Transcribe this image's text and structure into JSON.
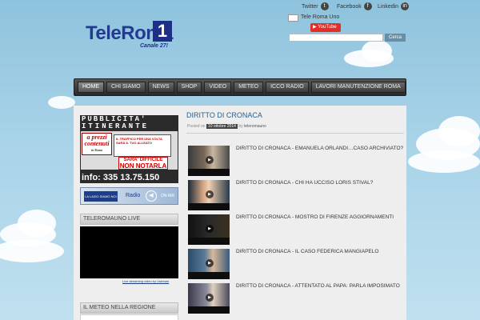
{
  "header": {
    "logo": {
      "word1": "Tele",
      "word2": "Roma",
      "number": "1",
      "tagline": "Canale 27!"
    },
    "social": [
      {
        "label": "Twitter",
        "icon": "twitter-icon"
      },
      {
        "label": "Facebook",
        "icon": "facebook-icon"
      },
      {
        "label": "Linkedin",
        "icon": "linkedin-icon"
      }
    ],
    "facebook_widget": {
      "page_name": "Tele Roma Uno",
      "youtube_label": "YouTube"
    },
    "search": {
      "placeholder": "",
      "button_label": "Cerca"
    }
  },
  "nav": {
    "items": [
      {
        "label": "HOME",
        "active": true
      },
      {
        "label": "CHI SIAMO"
      },
      {
        "label": "NEWS"
      },
      {
        "label": "SHOP"
      },
      {
        "label": "VIDEO"
      },
      {
        "label": "METEO"
      },
      {
        "label": "ICCO RADIO"
      },
      {
        "label": "LAVORI MANUTENZIONE ROMA"
      }
    ]
  },
  "sidebar": {
    "ad": {
      "title_line1": "PUBBLICITA'",
      "title_line2": "ITINERANTE",
      "badge": "a prezzi contenuti",
      "badge_sub": "in Roma",
      "truck_text": "IL TRAFFICO PER UNA VOLTA SARÀ IL TUO ALLEATO",
      "sign_line1": "SARA' DIFFICILE",
      "sign_line2": "NON NOTARLA",
      "phone": "info: 335  13.75.150"
    },
    "radio_banner": {
      "brand": "LA LAZIO SIAMO NOI",
      "label": "Radio",
      "status": "ON AIR"
    },
    "live_widget": {
      "title": "TELEROMAUNO LIVE",
      "link": "Live streaming video by Ustream"
    },
    "weather_widget": {
      "title": "IL METEO NELLA REGIONE"
    }
  },
  "main": {
    "title": "DIRITTO DI CRONACA",
    "meta": {
      "posted_on": "Posted on",
      "date": "10 ottobre 2014",
      "by": "by",
      "author": "teleromauno"
    },
    "videos": [
      {
        "title": "DIRITTO DI CRONACA - EMANUELA ORLANDI…CASO ARCHIVIATO?"
      },
      {
        "title": "DIRITTO DI CRONACA - CHI HA UCCISO LORIS STIVAL?"
      },
      {
        "title": "DIRITTO DI CRONACA - MOSTRO DI FIRENZE AGGIORNAMENTI"
      },
      {
        "title": "DIRITTO DI CRONACA - IL CASO FEDERICA MANGIAPELO"
      },
      {
        "title": "DIRITTO DI CRONACA - ATTENTATO AL PAPA: PARLA IMPOSIMATO"
      }
    ]
  },
  "colors": {
    "sky": "#a9d3e8",
    "nav_bar": "#2a2a2a",
    "title_link": "#2c5f8a",
    "logo_blue": "#243a8f"
  }
}
